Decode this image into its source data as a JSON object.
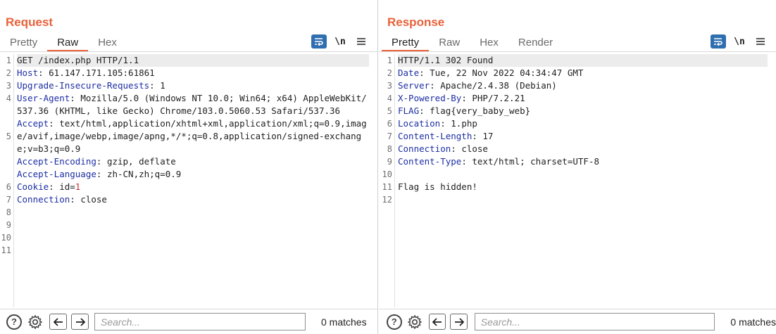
{
  "request": {
    "title": "Request",
    "tabs": [
      "Pretty",
      "Raw",
      "Hex"
    ],
    "active_tab": "Raw",
    "line_numbers": [
      "1",
      "2",
      "3",
      "4",
      "",
      "",
      "5",
      "",
      "",
      "",
      "6",
      "7",
      "8",
      "9",
      "10",
      "11"
    ],
    "lines": [
      "GET /index.php HTTP/1.1",
      {
        "key": "Host",
        "val": ": 61.147.171.105:61861"
      },
      {
        "key": "Upgrade-Insecure-Requests",
        "val": ": 1"
      },
      {
        "key": "User-Agent",
        "val": ": Mozilla/5.0 (Windows NT 10.0; Win64; x64) AppleWebKit/537.36 (KHTML, like Gecko) Chrome/103.0.5060.53 Safari/537.36"
      },
      {
        "key": "Accept",
        "val": ": text/html,application/xhtml+xml,application/xml;q=0.9,image/avif,image/webp,image/apng,*/*;q=0.8,application/signed-exchange;v=b3;q=0.9"
      },
      {
        "key": "Accept-Encoding",
        "val": ": gzip, deflate"
      },
      {
        "key": "Accept-Language",
        "val": ": zh-CN,zh;q=0.9"
      },
      {
        "key": "Cookie",
        "val": ": id=",
        "num": "1"
      },
      {
        "key": "Connection",
        "val": ": close"
      },
      "",
      ""
    ],
    "search_placeholder": "Search...",
    "matches": "0 matches"
  },
  "response": {
    "title": "Response",
    "tabs": [
      "Pretty",
      "Raw",
      "Hex",
      "Render"
    ],
    "active_tab": "Pretty",
    "line_numbers": [
      "1",
      "2",
      "3",
      "4",
      "5",
      "6",
      "7",
      "8",
      "9",
      "10",
      "11",
      "12"
    ],
    "lines": [
      "HTTP/1.1 302 Found",
      {
        "key": "Date",
        "val": ": Tue, 22 Nov 2022 04:34:47 GMT"
      },
      {
        "key": "Server",
        "val": ": Apache/2.4.38 (Debian)"
      },
      {
        "key": "X-Powered-By",
        "val": ": PHP/7.2.21"
      },
      {
        "key": "FLAG",
        "val": ": flag{very_baby_web}"
      },
      {
        "key": "Location",
        "val": ": 1.php"
      },
      {
        "key": "Content-Length",
        "val": ": 17"
      },
      {
        "key": "Connection",
        "val": ": close"
      },
      {
        "key": "Content-Type",
        "val": ": text/html; charset=UTF-8"
      },
      "",
      "Flag is hidden!",
      ""
    ],
    "search_placeholder": "Search...",
    "matches": "0 matches"
  },
  "tool_labels": {
    "newline": "\\n"
  },
  "icons": [
    "wrap-icon",
    "newline-icon",
    "menu-icon",
    "help-icon",
    "gear-icon",
    "arrow-left-icon",
    "arrow-right-icon",
    "layout-split-icon",
    "layout-horizontal-icon",
    "layout-vertical-icon"
  ],
  "colors": {
    "accent": "#e8623a",
    "header_key": "#1d2ea4",
    "number": "#cc2a2a",
    "tool_blue": "#2f6fb0"
  }
}
